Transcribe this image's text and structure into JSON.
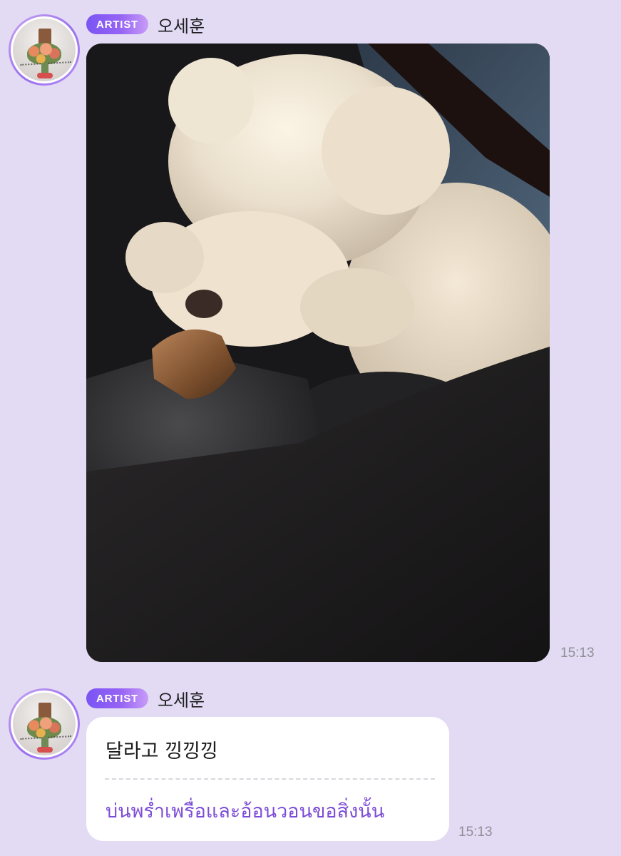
{
  "colors": {
    "background": "#e3dbf3",
    "badge_gradient_start": "#7a55f3",
    "badge_gradient_end": "#c89cf8",
    "translation_text": "#7c4dd6",
    "timestamp_text": "#8f8f97"
  },
  "messages": [
    {
      "badge": "ARTIST",
      "sender": "오세훈",
      "type": "photo",
      "image": "photo of a white fluffy poodle sniffing the leather arm of a sofa beside a dark coat",
      "time": "15:13"
    },
    {
      "badge": "ARTIST",
      "sender": "오세훈",
      "type": "text",
      "text": "달라고 낑낑낑",
      "translation": "บ่นพร่ำเพรื่อและอ้อนวอนขอสิ่งนั้น",
      "time": "15:13"
    }
  ]
}
